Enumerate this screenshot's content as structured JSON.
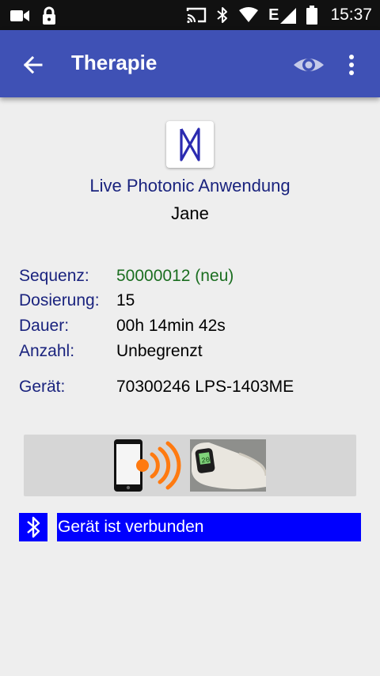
{
  "status_bar": {
    "time": "15:37",
    "network_letter": "E",
    "icons": [
      "video-camera-icon",
      "lock-icon",
      "cast-icon",
      "bluetooth-icon",
      "wifi-icon",
      "signal-icon",
      "battery-icon"
    ]
  },
  "app_bar": {
    "title": "Therapie",
    "background": "#3f51b5",
    "icons": [
      "back-arrow-icon",
      "eye-icon",
      "more-vert-icon"
    ]
  },
  "therapy": {
    "app_name": "Live Photonic Anwendung",
    "user": "Jane",
    "fields": [
      {
        "label": "Sequenz:",
        "value": "50000012 (neu)"
      },
      {
        "label": "Dosierung:",
        "value": "15"
      },
      {
        "label": "Dauer:",
        "value": "00h 14min 42s"
      },
      {
        "label": "Anzahl:",
        "value": "Unbegrenzt"
      },
      {
        "label": "Gerät:",
        "value": "70300246 LPS-1403ME"
      }
    ]
  },
  "connection": {
    "status_text": "Gerät ist verbunden",
    "status_color": "#0000ff",
    "icon": "bluetooth-icon"
  }
}
